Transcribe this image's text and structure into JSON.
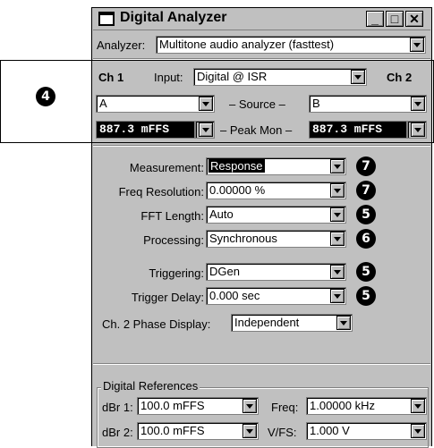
{
  "window": {
    "title": "Digital Analyzer",
    "minimize": "_",
    "maximize": "□",
    "close": "✕"
  },
  "analyzer": {
    "label": "Analyzer:",
    "value": "Multitone audio analyzer (fasttest)"
  },
  "channels": {
    "ch1": "Ch 1",
    "ch2": "Ch 2",
    "input_label": "Input:",
    "input_value": "Digital @ ISR",
    "source_label": "– Source –",
    "source_ch1": "A",
    "source_ch2": "B",
    "peakmon_label": "– Peak Mon –",
    "peakmon_ch1": "887.3   mFFS",
    "peakmon_ch2": "887.3   mFFS"
  },
  "settings": [
    {
      "label": "Measurement:",
      "value": "Response",
      "callout": "7"
    },
    {
      "label": "Freq Resolution:",
      "value": "0.00000  %",
      "callout": "7"
    },
    {
      "label": "FFT Length:",
      "value": "Auto",
      "callout": "5"
    },
    {
      "label": "Processing:",
      "value": "Synchronous",
      "callout": "6"
    },
    {
      "label": "Triggering:",
      "value": "DGen",
      "callout": "5"
    },
    {
      "label": "Trigger Delay:",
      "value": "0.000   sec",
      "callout": "5"
    }
  ],
  "phase_display": {
    "label": "Ch. 2 Phase Display:",
    "value": "Independent"
  },
  "references": {
    "group_label": "Digital References",
    "dbr1_label": "dBr 1:",
    "dbr1_value": "100.0   mFFS",
    "dbr2_label": "dBr 2:",
    "dbr2_value": "100.0   mFFS",
    "freq_label": "Freq:",
    "freq_value": "1.00000 kHz",
    "vfs_label": "V/FS:",
    "vfs_value": "1.000   V"
  },
  "side_callout": "4",
  "colors": {
    "face": "#c0c0c0",
    "highlight": "#000000",
    "meter_bg": "#000000"
  }
}
